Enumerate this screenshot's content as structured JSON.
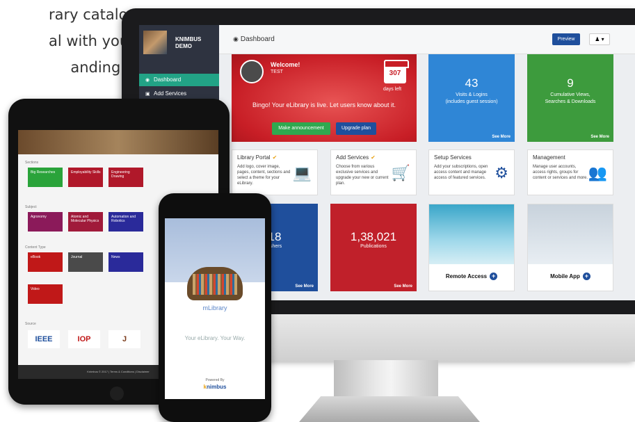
{
  "tagline": [
    "rary catalog",
    "al with your",
    "anding."
  ],
  "sidebar": {
    "brand": "KNIMBUS DEMO",
    "items": [
      {
        "label": "Dashboard",
        "icon": "dashboard-icon",
        "active": true
      },
      {
        "label": "Add Services",
        "icon": "cart-icon",
        "active": false
      }
    ]
  },
  "topbar": {
    "title": "Dashboard",
    "preview": "Preview"
  },
  "welcome": {
    "title": "Welcome!",
    "user": "TEST",
    "days": "307",
    "days_label": "days left",
    "message": "Bingo! Your eLibrary is live. Let users know about it.",
    "announce": "Make announcement",
    "upgrade": "Upgrade plan"
  },
  "stats": [
    {
      "value": "43",
      "label": "Visits & Logins",
      "label2": "(includes guest session)",
      "more": "See More",
      "color": "#2f86d6"
    },
    {
      "value": "9",
      "label": "Cumulative Views,",
      "label2": "Searches & Downloads",
      "more": "See More",
      "color": "#3d9b3d"
    }
  ],
  "cards": [
    {
      "title": "Library Portal",
      "check": "✔",
      "text": "Add logo, cover image, pages, content, sections and select a theme for your eLibrary.",
      "icon": "laptop-icon"
    },
    {
      "title": "Add Services",
      "check": "✔",
      "text": "Choose from various exclusive services and upgrade your new or current plan.",
      "icon": "cart-plus-icon"
    },
    {
      "title": "Setup Services",
      "check": "",
      "text": "Add your subscriptions, open access content and manage access of featured services.",
      "icon": "gears-icon"
    },
    {
      "title": "Management",
      "check": "",
      "text": "Manage user accounts, access rights, groups for content or services and more.",
      "icon": "users-icon"
    }
  ],
  "big": [
    {
      "value": "18",
      "label": "lishers",
      "more": "See More"
    },
    {
      "value": "1,38,021",
      "label": "Publications",
      "more": "See More"
    }
  ],
  "image_tiles": [
    {
      "label": "Remote Access",
      "plus": "+"
    },
    {
      "label": "Mobile App",
      "plus": "+"
    }
  ],
  "tablet": {
    "sections": [
      "Sections",
      "Subject",
      "Content Type",
      "Source"
    ],
    "section_thumbs": [
      {
        "label": "Big Researches",
        "color": "#2aa33a"
      },
      {
        "label": "Employability Skills",
        "color": "#b0182a"
      },
      {
        "label": "Engineering Drawing",
        "color": "#b0182a"
      }
    ],
    "subject_thumbs": [
      {
        "label": "Agronomy",
        "color": "#8b1a5a"
      },
      {
        "label": "Atomic and Molecular Physics",
        "color": "#a01a3a"
      },
      {
        "label": "Automation and Robotics",
        "color": "#2a2a9a"
      }
    ],
    "type_thumbs": [
      {
        "label": "eBook",
        "color": "#c01818"
      },
      {
        "label": "Journal",
        "color": "#4a4a4a"
      },
      {
        "label": "News",
        "color": "#2a2a9a"
      }
    ],
    "video": {
      "label": "Video",
      "color": "#c01818"
    },
    "pubs": [
      "IEEE",
      "IOP",
      "J"
    ],
    "footer": "Knimbus © 2017 | Terms & Conditions | Disclaimer"
  },
  "phone": {
    "app": "mLibrary",
    "slogan": "Your eLibrary. Your Way.",
    "powered": "Powered By",
    "brand_a": "k",
    "brand_b": "nimbus"
  }
}
